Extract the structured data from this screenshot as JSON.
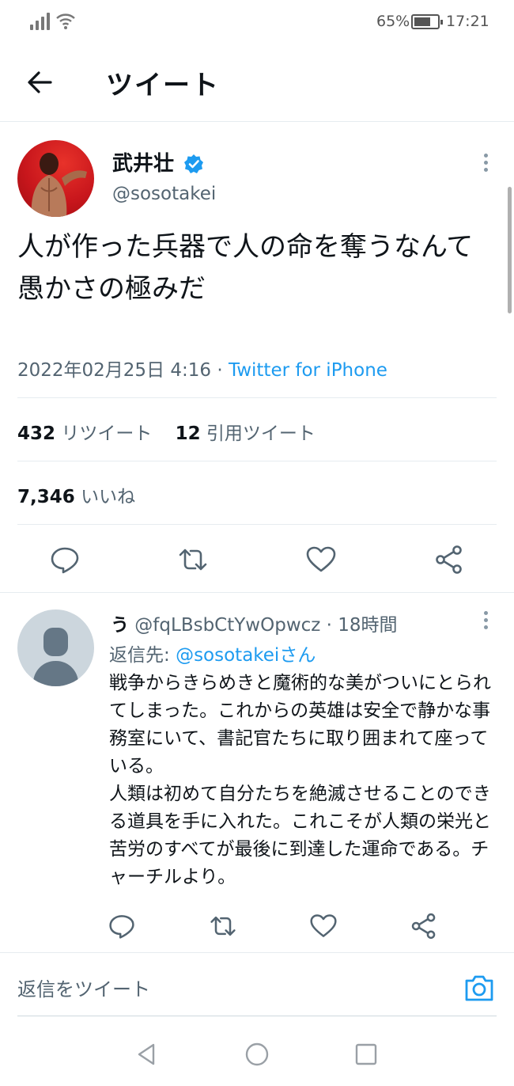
{
  "status_bar": {
    "battery": "65%",
    "time": "17:21"
  },
  "header": {
    "title": "ツイート"
  },
  "tweet": {
    "author_name": "武井壮",
    "handle": "@sosotakei",
    "text": "人が作った兵器で人の命を奪うなんて\n愚かさの極みだ",
    "date": "2022年02月25日 4:16 · ",
    "source": "Twitter for iPhone",
    "retweets_count": "432",
    "retweets_label": "リツイート",
    "quotes_count": "12",
    "quotes_label": "引用ツイート",
    "likes_count": "7,346",
    "likes_label": "いいね"
  },
  "reply": {
    "name": "う",
    "handle_time": " @fqLBsbCtYwOpwcz · 18時間",
    "reply_prefix": "返信先: ",
    "reply_mention": "@sosotakeiさん",
    "text": "戦争からきらめきと魔術的な美がついにとられてしまった。これからの英雄は安全で静かな事務室にいて、書記官たちに取り囲まれて座っている。\n人類は初めて自分たちを絶滅させることのできる道具を手に入れた。これこそが人類の栄光と苦労のすべてが最後に到達した運命である。チャーチルより。"
  },
  "compose": {
    "placeholder": "返信をツイート"
  },
  "icons": {
    "back": "arrow-left-icon",
    "verified": "verified-badge-icon",
    "reply": "comment-icon",
    "retweet": "retweet-icon",
    "like": "heart-icon",
    "share": "share-icon",
    "camera": "camera-icon"
  },
  "colors": {
    "accent": "#1d9bf0",
    "muted": "#536471",
    "text": "#0f1419"
  }
}
